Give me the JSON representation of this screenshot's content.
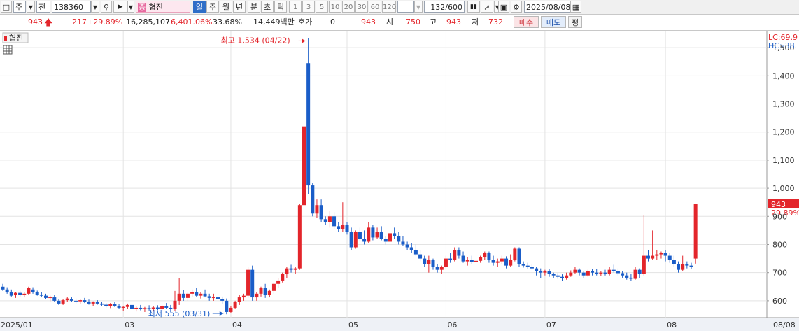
{
  "toolbar": {
    "market": "주",
    "price_type": "전",
    "code": "138360",
    "badge": "증",
    "name": "협진",
    "periods": [
      "일",
      "주",
      "월",
      "년",
      "분",
      "초",
      "틱"
    ],
    "active_period": "일",
    "intervals": [
      "1",
      "3",
      "5",
      "10",
      "20",
      "30",
      "60",
      "120"
    ],
    "count": "132/600",
    "date": "2025/08/08"
  },
  "quote": {
    "price": "943",
    "change": "217",
    "change_pct": "+29.89%",
    "volume": "16,285,107",
    "volume_ratio": "6,401.06%",
    "turnover": "33.68%",
    "amount": "14,449백만",
    "hoga_label": "호가",
    "hoga_value": "0",
    "hoga_price": "943",
    "open_label": "시",
    "open": "750",
    "high_label": "고",
    "high": "943",
    "low_label": "저",
    "low": "732",
    "buy_label": "매수",
    "sell_label": "매도",
    "eval_label": "평"
  },
  "chart_data": {
    "type": "candlestick",
    "series_label": "협진",
    "legend": {
      "lc": "LC:69.9",
      "hc": "HC:-38."
    },
    "y_ticks": [
      "1,500",
      "1,400",
      "1,300",
      "1,200",
      "1,100",
      "1,000",
      "900",
      "800",
      "700",
      "600"
    ],
    "ylim": [
      540,
      1560
    ],
    "x_ticks": [
      {
        "label": "2025/01",
        "i": 0
      },
      {
        "label": "03",
        "i": 28
      },
      {
        "label": "04",
        "i": 53
      },
      {
        "label": "05",
        "i": 80
      },
      {
        "label": "06",
        "i": 103
      },
      {
        "label": "07",
        "i": 126
      },
      {
        "label": "08",
        "i": 154
      }
    ],
    "x_end_label": "08/08",
    "current": {
      "price": "943",
      "pct": "29.89%"
    },
    "annotations": {
      "high": {
        "text": "최고 1,534 (04/22)",
        "i": 71,
        "value": 1534
      },
      "low": {
        "text": "최저 555 (03/31)",
        "i": 52,
        "value": 555
      }
    },
    "candles": [
      [
        650,
        660,
        635,
        640
      ],
      [
        640,
        648,
        625,
        630
      ],
      [
        630,
        640,
        615,
        618
      ],
      [
        620,
        632,
        610,
        628
      ],
      [
        628,
        635,
        615,
        620
      ],
      [
        622,
        630,
        612,
        625
      ],
      [
        625,
        650,
        620,
        645
      ],
      [
        640,
        648,
        625,
        630
      ],
      [
        630,
        636,
        618,
        622
      ],
      [
        622,
        630,
        612,
        618
      ],
      [
        618,
        625,
        605,
        610
      ],
      [
        610,
        618,
        598,
        612
      ],
      [
        612,
        620,
        596,
        600
      ],
      [
        600,
        606,
        585,
        590
      ],
      [
        590,
        606,
        585,
        602
      ],
      [
        602,
        612,
        595,
        608
      ],
      [
        606,
        612,
        596,
        600
      ],
      [
        600,
        608,
        590,
        598
      ],
      [
        598,
        605,
        588,
        602
      ],
      [
        602,
        610,
        592,
        596
      ],
      [
        596,
        604,
        586,
        590
      ],
      [
        590,
        598,
        582,
        595
      ],
      [
        595,
        602,
        586,
        590
      ],
      [
        590,
        596,
        580,
        586
      ],
      [
        586,
        592,
        576,
        582
      ],
      [
        582,
        592,
        574,
        588
      ],
      [
        588,
        596,
        578,
        580
      ],
      [
        580,
        588,
        570,
        575
      ],
      [
        575,
        582,
        565,
        578
      ],
      [
        578,
        590,
        570,
        585
      ],
      [
        585,
        592,
        568,
        572
      ],
      [
        572,
        580,
        562,
        575
      ],
      [
        575,
        585,
        566,
        570
      ],
      [
        570,
        578,
        560,
        574
      ],
      [
        574,
        584,
        565,
        570
      ],
      [
        570,
        580,
        562,
        576
      ],
      [
        576,
        584,
        566,
        572
      ],
      [
        572,
        585,
        565,
        580
      ],
      [
        580,
        592,
        570,
        575
      ],
      [
        575,
        585,
        560,
        570
      ],
      [
        570,
        635,
        565,
        600
      ],
      [
        600,
        680,
        585,
        625
      ],
      [
        625,
        638,
        600,
        610
      ],
      [
        610,
        630,
        600,
        625
      ],
      [
        625,
        640,
        612,
        630
      ],
      [
        630,
        645,
        615,
        618
      ],
      [
        618,
        632,
        608,
        625
      ],
      [
        625,
        640,
        612,
        616
      ],
      [
        616,
        625,
        600,
        610
      ],
      [
        610,
        625,
        600,
        612
      ],
      [
        612,
        622,
        598,
        605
      ],
      [
        605,
        615,
        590,
        600
      ],
      [
        600,
        608,
        552,
        560
      ],
      [
        560,
        580,
        555,
        575
      ],
      [
        575,
        600,
        570,
        595
      ],
      [
        595,
        620,
        585,
        612
      ],
      [
        612,
        625,
        600,
        618
      ],
      [
        618,
        720,
        610,
        710
      ],
      [
        710,
        725,
        600,
        612
      ],
      [
        612,
        630,
        600,
        625
      ],
      [
        625,
        650,
        615,
        645
      ],
      [
        645,
        660,
        610,
        620
      ],
      [
        620,
        640,
        612,
        635
      ],
      [
        635,
        665,
        625,
        660
      ],
      [
        660,
        680,
        645,
        672
      ],
      [
        672,
        700,
        665,
        695
      ],
      [
        695,
        720,
        680,
        715
      ],
      [
        715,
        728,
        700,
        710
      ],
      [
        710,
        720,
        695,
        715
      ],
      [
        715,
        945,
        710,
        940
      ],
      [
        940,
        1230,
        935,
        1220
      ],
      [
        1445,
        1534,
        980,
        1010
      ],
      [
        1010,
        1020,
        900,
        910
      ],
      [
        910,
        960,
        895,
        940
      ],
      [
        940,
        960,
        880,
        890
      ],
      [
        890,
        900,
        870,
        880
      ],
      [
        880,
        920,
        860,
        900
      ],
      [
        900,
        915,
        855,
        865
      ],
      [
        865,
        880,
        845,
        855
      ],
      [
        855,
        950,
        845,
        870
      ],
      [
        870,
        880,
        835,
        845
      ],
      [
        845,
        860,
        780,
        790
      ],
      [
        790,
        850,
        785,
        845
      ],
      [
        845,
        860,
        810,
        820
      ],
      [
        820,
        850,
        800,
        810
      ],
      [
        810,
        880,
        805,
        860
      ],
      [
        860,
        870,
        815,
        825
      ],
      [
        825,
        860,
        820,
        845
      ],
      [
        845,
        865,
        815,
        820
      ],
      [
        820,
        830,
        800,
        810
      ],
      [
        810,
        850,
        800,
        840
      ],
      [
        840,
        860,
        820,
        830
      ],
      [
        830,
        845,
        800,
        810
      ],
      [
        810,
        830,
        795,
        800
      ],
      [
        800,
        810,
        780,
        790
      ],
      [
        790,
        805,
        770,
        780
      ],
      [
        780,
        800,
        760,
        765
      ],
      [
        765,
        780,
        740,
        750
      ],
      [
        750,
        760,
        720,
        730
      ],
      [
        730,
        760,
        700,
        745
      ],
      [
        745,
        750,
        710,
        720
      ],
      [
        720,
        730,
        700,
        710
      ],
      [
        710,
        725,
        695,
        720
      ],
      [
        720,
        760,
        715,
        750
      ],
      [
        750,
        770,
        735,
        745
      ],
      [
        745,
        790,
        740,
        780
      ],
      [
        780,
        790,
        750,
        760
      ],
      [
        760,
        775,
        735,
        740
      ],
      [
        740,
        755,
        725,
        745
      ],
      [
        745,
        760,
        730,
        738
      ],
      [
        738,
        750,
        728,
        742
      ],
      [
        742,
        760,
        735,
        756
      ],
      [
        756,
        775,
        745,
        770
      ],
      [
        770,
        775,
        735,
        745
      ],
      [
        745,
        760,
        725,
        735
      ],
      [
        735,
        750,
        720,
        740
      ],
      [
        740,
        760,
        730,
        750
      ],
      [
        750,
        758,
        715,
        725
      ],
      [
        725,
        765,
        720,
        745
      ],
      [
        745,
        790,
        740,
        785
      ],
      [
        785,
        790,
        720,
        730
      ],
      [
        730,
        740,
        718,
        725
      ],
      [
        725,
        735,
        712,
        720
      ],
      [
        720,
        730,
        710,
        715
      ],
      [
        715,
        720,
        690,
        705
      ],
      [
        705,
        715,
        680,
        700
      ],
      [
        700,
        710,
        690,
        705
      ],
      [
        705,
        712,
        685,
        695
      ],
      [
        695,
        700,
        680,
        690
      ],
      [
        690,
        698,
        678,
        685
      ],
      [
        685,
        694,
        670,
        680
      ],
      [
        680,
        700,
        675,
        690
      ],
      [
        690,
        708,
        685,
        700
      ],
      [
        700,
        720,
        695,
        710
      ],
      [
        710,
        715,
        690,
        700
      ],
      [
        700,
        706,
        680,
        690
      ],
      [
        690,
        710,
        685,
        705
      ],
      [
        705,
        712,
        690,
        700
      ],
      [
        700,
        712,
        690,
        695
      ],
      [
        695,
        705,
        688,
        700
      ],
      [
        700,
        710,
        690,
        695
      ],
      [
        695,
        720,
        690,
        710
      ],
      [
        710,
        728,
        700,
        705
      ],
      [
        705,
        715,
        690,
        698
      ],
      [
        698,
        706,
        682,
        690
      ],
      [
        690,
        700,
        675,
        682
      ],
      [
        682,
        695,
        670,
        678
      ],
      [
        678,
        720,
        675,
        710
      ],
      [
        710,
        715,
        680,
        695
      ],
      [
        695,
        905,
        690,
        760
      ],
      [
        760,
        780,
        740,
        750
      ],
      [
        750,
        850,
        745,
        760
      ],
      [
        760,
        780,
        745,
        765
      ],
      [
        765,
        775,
        750,
        770
      ],
      [
        770,
        780,
        740,
        760
      ],
      [
        760,
        770,
        735,
        745
      ],
      [
        745,
        760,
        720,
        730
      ],
      [
        730,
        740,
        700,
        710
      ],
      [
        710,
        760,
        705,
        730
      ],
      [
        730,
        740,
        715,
        725
      ],
      [
        725,
        735,
        712,
        720
      ],
      [
        750,
        943,
        732,
        943
      ]
    ]
  }
}
